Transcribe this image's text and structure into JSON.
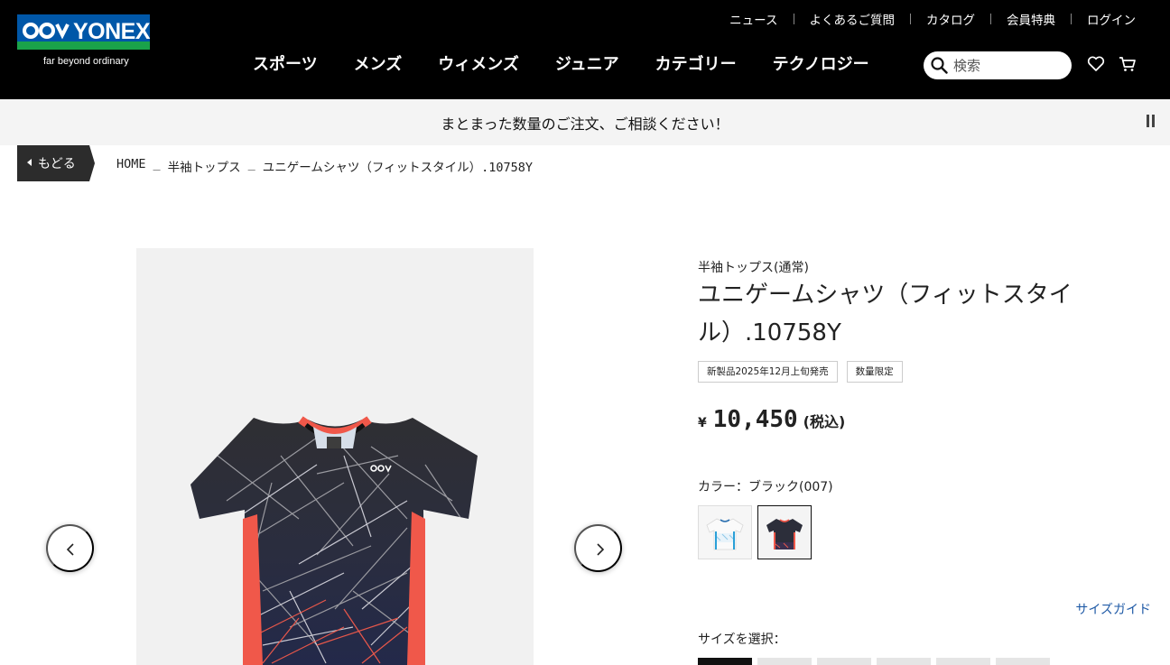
{
  "colors": {
    "header_bg": "#000000",
    "logo_blue": "#0057a8",
    "logo_green": "#1aa24a",
    "link_blue": "#1f5aa6",
    "shirt_accent": "#f0584a"
  },
  "header": {
    "logo": {
      "brand": "YONEX",
      "tagline": "far beyond ordinary"
    },
    "utility_links": [
      "ニュース",
      "よくあるご質問",
      "カタログ",
      "会員特典",
      "ログイン"
    ],
    "main_nav": [
      "スポーツ",
      "メンズ",
      "ウィメンズ",
      "ジュニア",
      "カテゴリー",
      "テクノロジー"
    ],
    "search": {
      "placeholder": "検索",
      "value": ""
    },
    "icons": [
      "search-icon",
      "heart-icon",
      "cart-icon"
    ]
  },
  "announcement": {
    "text": "まとまった数量のご注文、ご相談ください！"
  },
  "breadcrumb": {
    "back_label": "もどる",
    "items": [
      "HOME",
      "半袖トップス",
      "ユニゲームシャツ（フィットスタイル）.10758Y"
    ],
    "separator": "_"
  },
  "product": {
    "category": "半袖トップス(通常)",
    "title": "ユニゲームシャツ（フィットスタイル）.10758Y",
    "badges": [
      "新製品2025年12月上旬発売",
      "数量限定"
    ],
    "price": {
      "currency": "¥",
      "amount": "10,450",
      "tax_note": "(税込)"
    },
    "color_label": "カラー：ブラック(007)",
    "colors": [
      {
        "name": "white",
        "selected": false
      },
      {
        "name": "black",
        "selected": true
      }
    ],
    "size_guide_label": "サイズガイド",
    "size_label": "サイズを選択："
  }
}
